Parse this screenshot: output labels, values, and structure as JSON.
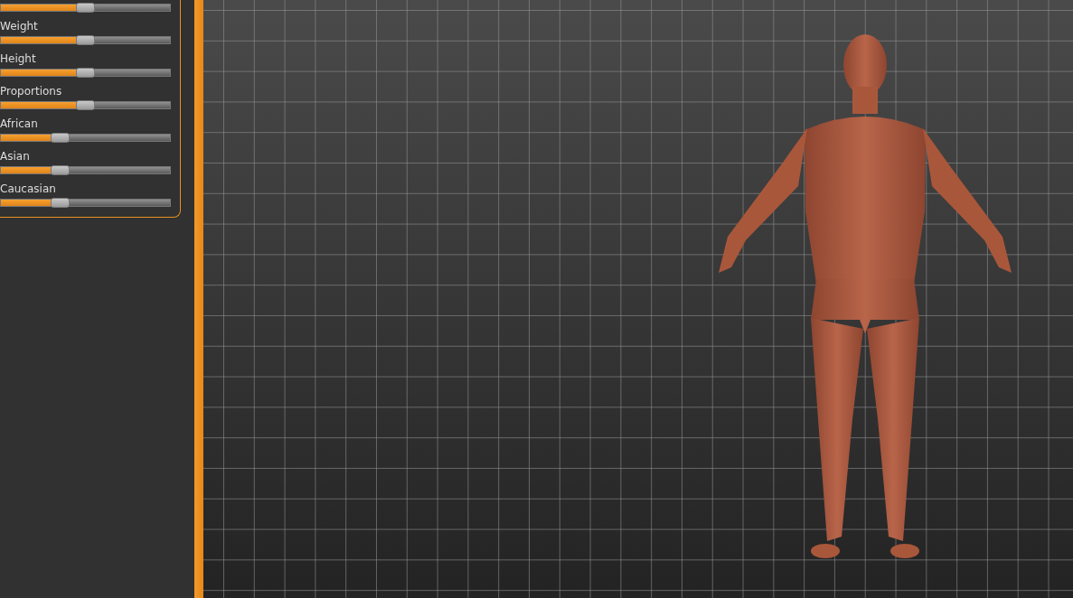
{
  "sliders": [
    {
      "level": 0.5
    },
    {
      "label": "Weight",
      "level": 0.5
    },
    {
      "label": "Height",
      "level": 0.5
    },
    {
      "label": "Proportions",
      "level": 0.5
    },
    {
      "label": "African",
      "level": 0.333
    },
    {
      "label": "Asian",
      "level": 0.333
    },
    {
      "label": "Caucasian",
      "level": 0.333
    }
  ]
}
